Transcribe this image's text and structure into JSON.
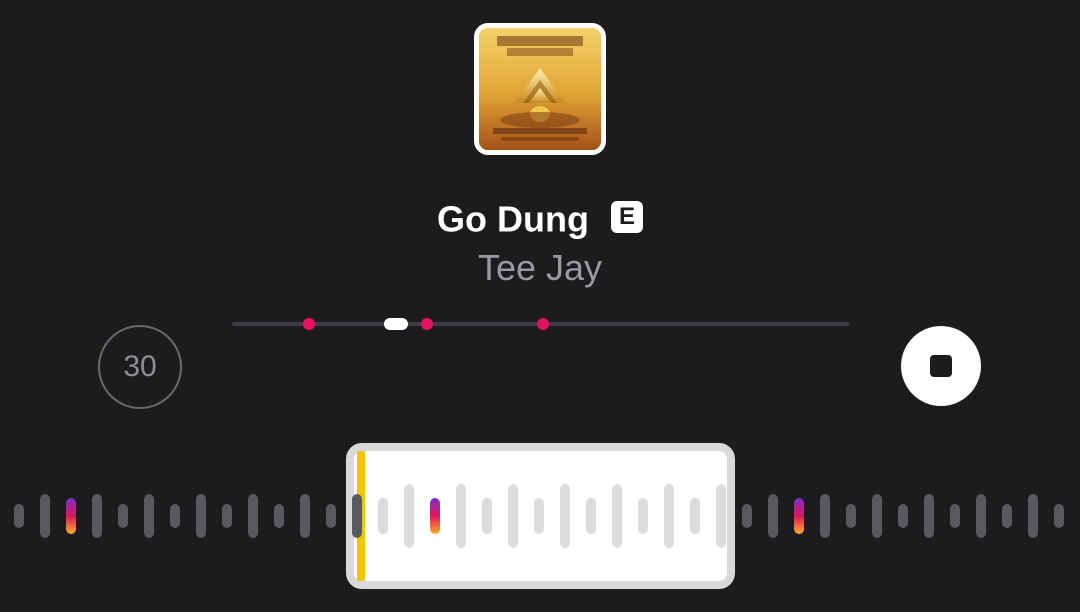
{
  "track": {
    "title": "Go Dung",
    "explicit_label": "E",
    "artist": "Tee Jay"
  },
  "controls": {
    "skip_label": "30"
  },
  "colors": {
    "background": "#1c1c1f",
    "accent_marker": "#e5135e",
    "selection_edge": "#f5c400"
  },
  "icons": {
    "stop": "stop-icon",
    "album": "album-art-image"
  }
}
